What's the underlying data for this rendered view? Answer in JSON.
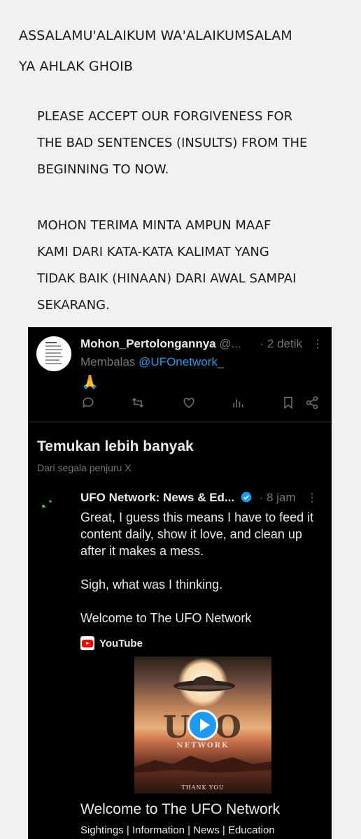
{
  "greeting": {
    "line1": "ASSALAMU'ALAIKUM WA'ALAIKUMSALAM",
    "line2": "YA AHLAK GHOIB"
  },
  "message_en": {
    "lines": [
      "PLEASE ACCEPT OUR FORGIVENESS FOR",
      "THE BAD SENTENCES (INSULTS) FROM THE",
      "BEGINNING TO NOW."
    ]
  },
  "message_id": {
    "lines": [
      "MOHON TERIMA MINTA AMPUN MAAF",
      "KAMI DARI KATA-KATA KALIMAT YANG",
      "TIDAK BAIK (HINAAN) DARI AWAL SAMPAI",
      "SEKARANG."
    ]
  },
  "reply_tweet": {
    "display_name": "Mohon_Pertolongannya",
    "handle": "@...",
    "time": "· 2 detik",
    "more": "⋮",
    "replying_to_label": "Membalas",
    "replying_to_handle": "@UFOnetwork_",
    "emoji": "🙏",
    "actions": [
      "reply-icon",
      "retweet-icon",
      "like-icon",
      "views-icon",
      "bookmark-icon",
      "share-icon"
    ]
  },
  "explore": {
    "title": "Temukan lebih banyak",
    "subtitle": "Dari segala penjuru X"
  },
  "ufo_tweet": {
    "display_name": "UFO Network: News & Ed...",
    "time": "· 8 jam",
    "more": "⋮",
    "body": [
      "Great, I guess this means I have to feed it content daily, show it love, and clean up after it makes a mess.",
      "Sigh, what was I thinking.",
      "Welcome to The UFO Network"
    ],
    "source": "YouTube",
    "thumbnail_words": {
      "top": "NETWORK",
      "bottom": "THANK YOU",
      "logo": "UFO"
    },
    "card_title": "Welcome to The UFO Network",
    "card_subtitle": "Sightings | Information | News | Education"
  },
  "colors": {
    "accent": "#1d9bf0",
    "muted": "#71767b",
    "panel": "#000000",
    "page": "#f3f1ef"
  }
}
